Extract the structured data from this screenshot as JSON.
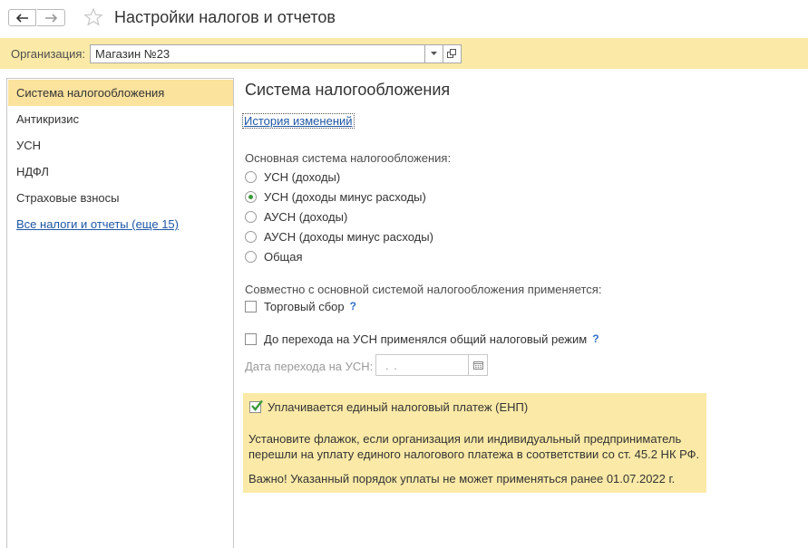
{
  "window": {
    "title": "Настройки налогов и отчетов",
    "icons": {
      "back": "arrow-left-icon",
      "forward": "arrow-right-icon",
      "favorite": "star-icon"
    }
  },
  "organization": {
    "label": "Организация:",
    "value": "Магазин №23"
  },
  "sidebar": {
    "items": [
      {
        "label": "Система налогообложения",
        "active": true
      },
      {
        "label": "Антикризис"
      },
      {
        "label": "УСН"
      },
      {
        "label": "НДФЛ"
      },
      {
        "label": "Страховые взносы"
      }
    ],
    "more_link": "Все налоги и отчеты (еще 15)"
  },
  "main": {
    "section_title": "Система налогообложения",
    "history_link": "История изменений",
    "tax_system_label": "Основная система налогообложения:",
    "tax_options": [
      {
        "label": "УСН (доходы)",
        "selected": false
      },
      {
        "label": "УСН (доходы минус расходы)",
        "selected": true
      },
      {
        "label": "АУСН (доходы)",
        "selected": false
      },
      {
        "label": "АУСН (доходы минус расходы)",
        "selected": false
      },
      {
        "label": "Общая",
        "selected": false
      }
    ],
    "combined_label": "Совместно с основной системой налогообложения применяется:",
    "trade_fee": {
      "label": "Торговый сбор",
      "checked": false,
      "help": "?"
    },
    "prior_general": {
      "label": "До перехода на УСН применялся общий налоговый режим",
      "checked": false,
      "help": "?"
    },
    "transition_date": {
      "label": "Дата перехода на УСН:",
      "value": " .  .  "
    },
    "enp": {
      "label": "Уплачивается единый налоговый платеж (ЕНП)",
      "checked": true,
      "description": "Установите флажок, если организация или индивидуальный предприниматель перешли на уплату единого налогового платежа в соответствии со ст. 45.2 НК РФ.",
      "warning": "Важно! Указанный порядок уплаты не может применяться ранее 01.07.2022 г."
    }
  },
  "colors": {
    "accent_bar": "#fbeaa7",
    "active_item": "#fbe29d",
    "link": "#1f57a6",
    "radio_selected": "#3a9a3a",
    "checkmark": "#3a9a3a"
  }
}
